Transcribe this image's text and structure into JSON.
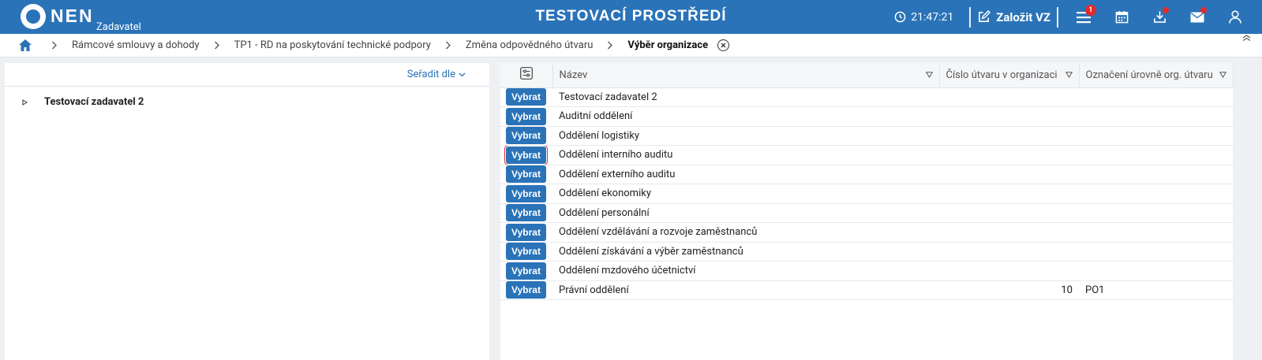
{
  "header": {
    "logo_text": "NEN",
    "logo_sub": "Zadavatel",
    "env_title": "TESTOVACÍ PROSTŘEDÍ",
    "clock": "21:47:21",
    "create_label": "Založit VZ",
    "menu_badge": "1",
    "colors": {
      "bar": "#2a73b8",
      "badge": "#e32a2a"
    }
  },
  "breadcrumb": {
    "items": [
      "Rámcové smlouvy a dohody",
      "TP1 - RD na poskytování technické podpory",
      "Změna odpovědného útvaru"
    ],
    "current": "Výběr organizace"
  },
  "tree": {
    "sort_label": "Seřadit dle",
    "root": "Testovací zadavatel 2"
  },
  "table": {
    "columns": [
      "Název",
      "Číslo útvaru v organizaci",
      "Označení úrovně org. útvaru"
    ],
    "button_label": "Vybrat",
    "rows": [
      {
        "name": "Testovací zadavatel 2",
        "number": "",
        "level": ""
      },
      {
        "name": "Auditní oddělení",
        "number": "",
        "level": ""
      },
      {
        "name": "Oddělení logistiky",
        "number": "",
        "level": ""
      },
      {
        "name": "Oddělení interního auditu",
        "number": "",
        "level": ""
      },
      {
        "name": "Oddělení externího auditu",
        "number": "",
        "level": ""
      },
      {
        "name": "Oddělení ekonomiky",
        "number": "",
        "level": ""
      },
      {
        "name": "Oddělení personální",
        "number": "",
        "level": ""
      },
      {
        "name": "Oddělení vzdělávání a rozvoje zaměstnanců",
        "number": "",
        "level": ""
      },
      {
        "name": "Oddělení získávání a výběr zaměstnanců",
        "number": "",
        "level": ""
      },
      {
        "name": "Oddělení mzdového účetnictví",
        "number": "",
        "level": ""
      },
      {
        "name": "Právní oddělení",
        "number": "10",
        "level": "PO1"
      }
    ]
  }
}
